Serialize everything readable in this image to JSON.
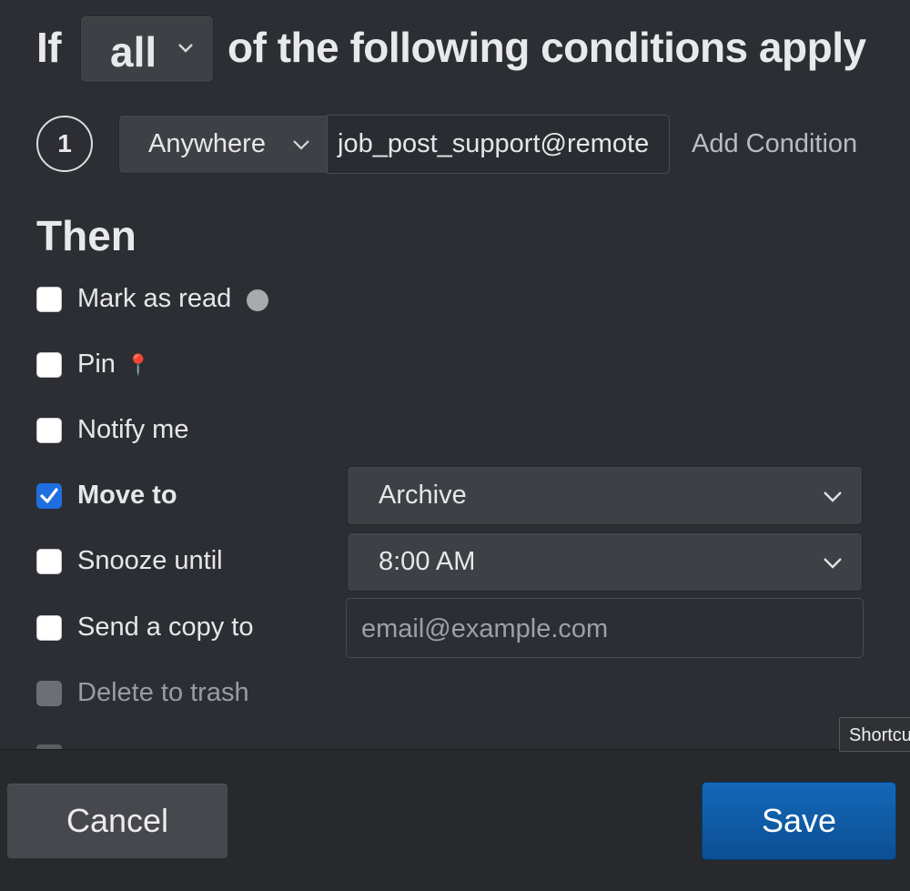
{
  "rule": {
    "if_label": "If",
    "match_value": "all",
    "following_label": "of the following conditions apply"
  },
  "condition": {
    "number": "1",
    "field": "Anywhere",
    "value": "job_post_support@remote",
    "add_label": "Add Condition"
  },
  "then_heading": "Then",
  "actions": {
    "mark_read": {
      "label": "Mark as read",
      "checked": false
    },
    "pin": {
      "label": "Pin",
      "icon": "📍",
      "checked": false
    },
    "notify": {
      "label": "Notify me",
      "checked": false
    },
    "move_to": {
      "label": "Move to",
      "checked": true,
      "value": "Archive"
    },
    "snooze": {
      "label": "Snooze until",
      "checked": false,
      "value": "8:00 AM"
    },
    "send_copy": {
      "label": "Send a copy to",
      "checked": false,
      "placeholder": "email@example.com"
    },
    "delete": {
      "label": "Delete to trash",
      "checked": false,
      "disabled": true
    }
  },
  "tooltip": "Shortcu",
  "footer": {
    "cancel": "Cancel",
    "save": "Save"
  },
  "colors": {
    "background": "#2c2e33",
    "checkbox_checked": "#1f6fe0",
    "save_button": "#0b5aa6"
  }
}
